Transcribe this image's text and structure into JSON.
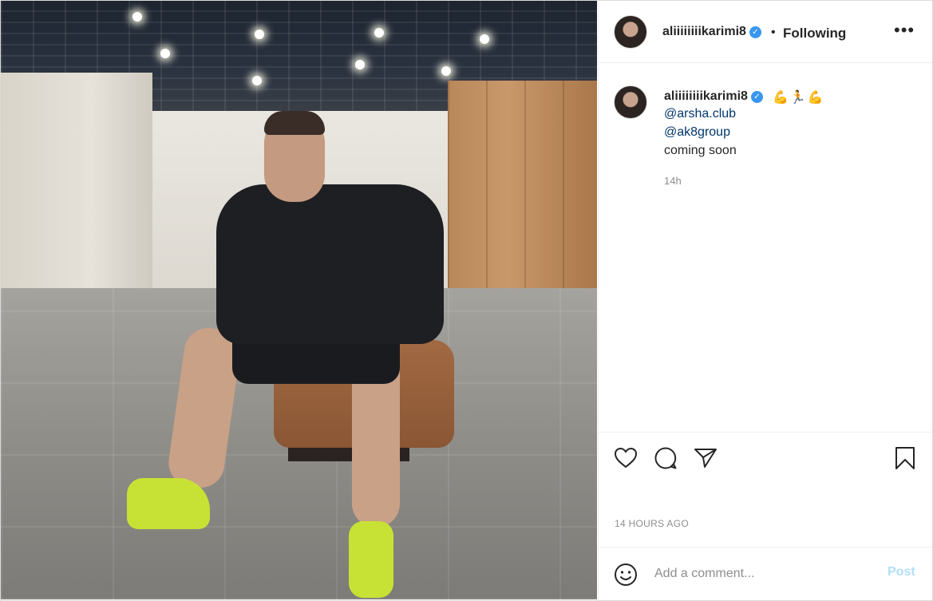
{
  "post": {
    "username": "aliiiiiiiikarimi8",
    "follow_status": "Following",
    "separator": "•",
    "more_label": "•••",
    "verified_mark": "✓"
  },
  "caption": {
    "username": "aliiiiiiiikarimi8",
    "emojis": "💪🏃💪",
    "mention_1": "@arsha.club",
    "mention_2": "@ak8group",
    "text": "coming soon",
    "time_short": "14h"
  },
  "actions": {
    "like_icon": "heart-icon",
    "comment_icon": "comment-icon",
    "share_icon": "share-icon",
    "save_icon": "bookmark-icon"
  },
  "time_ago": "14 HOURS AGO",
  "comment_box": {
    "placeholder": "Add a comment...",
    "post_label": "Post",
    "emoji_icon": "emoji-icon"
  },
  "colors": {
    "link": "#00376b",
    "verified": "#3897f0",
    "post_disabled": "#b2dffc",
    "muted": "#8e8e8e"
  }
}
